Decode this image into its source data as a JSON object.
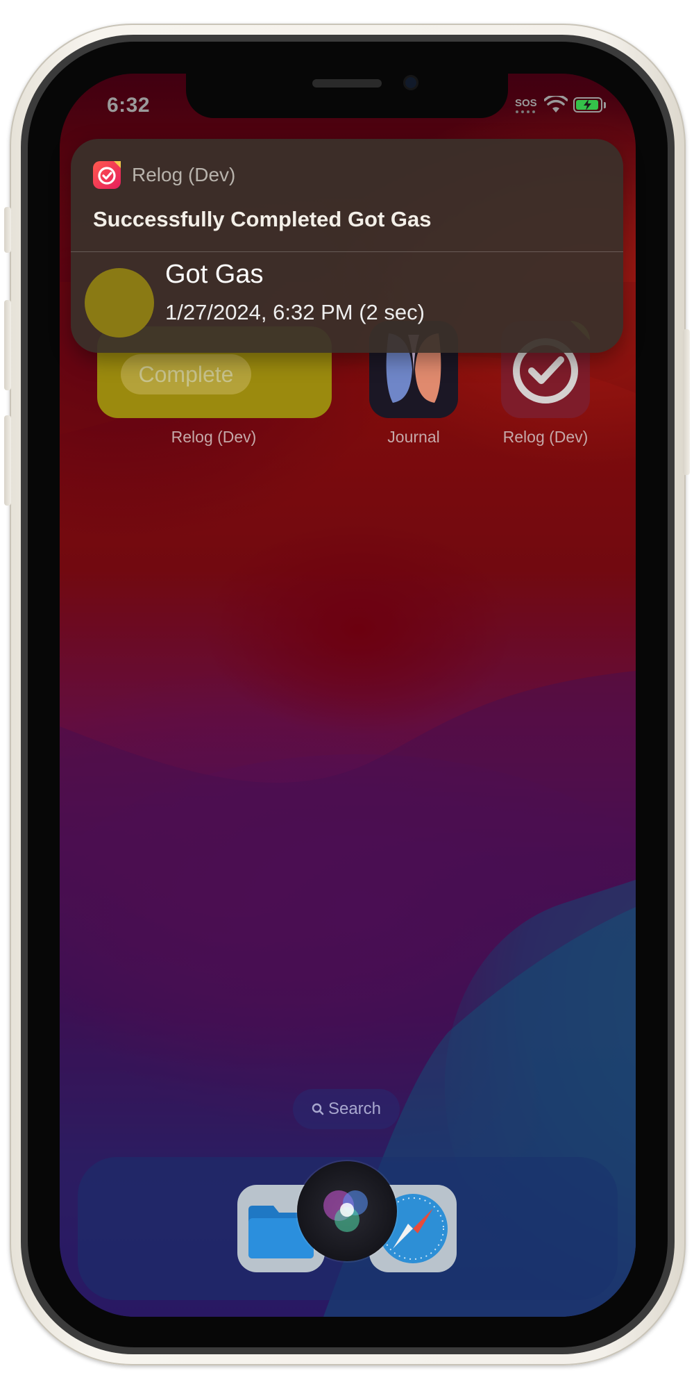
{
  "status_bar": {
    "time": "6:32",
    "carrier": "SOS",
    "battery_charging": true
  },
  "notification": {
    "app_name": "Relog (Dev)",
    "title": "Successfully Completed Got Gas",
    "item_name": "Got Gas",
    "item_detail": "1/27/2024, 6:32 PM (2 sec)"
  },
  "home_screen": {
    "widget_button": "Complete",
    "apps": [
      {
        "label": "Relog (Dev)",
        "icon": "relog-widget"
      },
      {
        "label": "Journal",
        "icon": "journal-icon"
      },
      {
        "label": "Relog (Dev)",
        "icon": "relog-icon"
      }
    ],
    "search_label": "Search"
  },
  "dock": {
    "apps": [
      {
        "icon": "files-icon"
      },
      {
        "icon": "safari-icon"
      }
    ],
    "siri": "siri-orb-icon"
  },
  "colors": {
    "notification_bg": "#3a302a",
    "widget_yellow": "#9b8a0e",
    "battery_green": "#35c24a",
    "relog_accent": "#e51d5c"
  }
}
